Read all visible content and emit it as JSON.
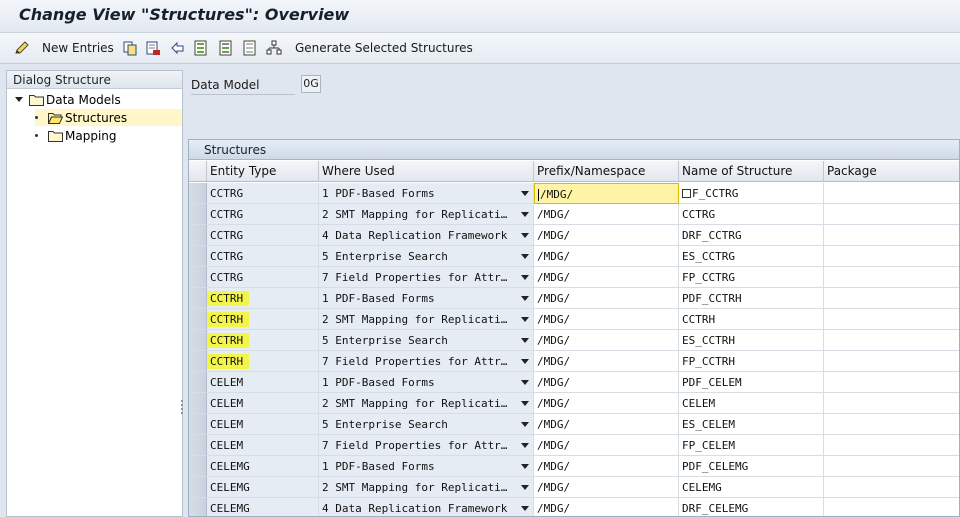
{
  "title": "Change View \"Structures\": Overview",
  "toolbar": {
    "new_entries": "New Entries",
    "generate": "Generate Selected Structures"
  },
  "dialog": {
    "header": "Dialog Structure",
    "items": [
      {
        "label": "Data Models"
      },
      {
        "label": "Structures"
      },
      {
        "label": "Mapping"
      }
    ]
  },
  "data_model": {
    "label": "Data Model",
    "value": "0G"
  },
  "grid": {
    "title": "Structures",
    "columns": [
      "Entity Type",
      "Where Used",
      "Prefix/Namespace",
      "Name of Structure",
      "Package"
    ],
    "rows": [
      {
        "entity": "CCTRG",
        "where": "1 PDF-Based Forms",
        "prefix": "/MDG/",
        "name": "F_CCTRG",
        "package": ""
      },
      {
        "entity": "CCTRG",
        "where": "2 SMT Mapping for Replicati…",
        "prefix": "/MDG/",
        "name": "CCTRG",
        "package": ""
      },
      {
        "entity": "CCTRG",
        "where": "4 Data Replication Framework",
        "prefix": "/MDG/",
        "name": "DRF_CCTRG",
        "package": ""
      },
      {
        "entity": "CCTRG",
        "where": "5 Enterprise Search",
        "prefix": "/MDG/",
        "name": "ES_CCTRG",
        "package": ""
      },
      {
        "entity": "CCTRG",
        "where": "7 Field Properties for Attr…",
        "prefix": "/MDG/",
        "name": "FP_CCTRG",
        "package": ""
      },
      {
        "entity": "CCTRH",
        "where": "1 PDF-Based Forms",
        "prefix": "/MDG/",
        "name": "PDF_CCTRH",
        "package": ""
      },
      {
        "entity": "CCTRH",
        "where": "2 SMT Mapping for Replicati…",
        "prefix": "/MDG/",
        "name": "CCTRH",
        "package": ""
      },
      {
        "entity": "CCTRH",
        "where": "5 Enterprise Search",
        "prefix": "/MDG/",
        "name": "ES_CCTRH",
        "package": ""
      },
      {
        "entity": "CCTRH",
        "where": "7 Field Properties for Attr…",
        "prefix": "/MDG/",
        "name": "FP_CCTRH",
        "package": ""
      },
      {
        "entity": "CELEM",
        "where": "1 PDF-Based Forms",
        "prefix": "/MDG/",
        "name": "PDF_CELEM",
        "package": ""
      },
      {
        "entity": "CELEM",
        "where": "2 SMT Mapping for Replicati…",
        "prefix": "/MDG/",
        "name": "CELEM",
        "package": ""
      },
      {
        "entity": "CELEM",
        "where": "5 Enterprise Search",
        "prefix": "/MDG/",
        "name": "ES_CELEM",
        "package": ""
      },
      {
        "entity": "CELEM",
        "where": "7 Field Properties for Attr…",
        "prefix": "/MDG/",
        "name": "FP_CELEM",
        "package": ""
      },
      {
        "entity": "CELEMG",
        "where": "1 PDF-Based Forms",
        "prefix": "/MDG/",
        "name": "PDF_CELEMG",
        "package": ""
      },
      {
        "entity": "CELEMG",
        "where": "2 SMT Mapping for Replicati…",
        "prefix": "/MDG/",
        "name": "CELEMG",
        "package": ""
      },
      {
        "entity": "CELEMG",
        "where": "4 Data Replication Framework",
        "prefix": "/MDG/",
        "name": "DRF_CELEMG",
        "package": ""
      }
    ]
  }
}
